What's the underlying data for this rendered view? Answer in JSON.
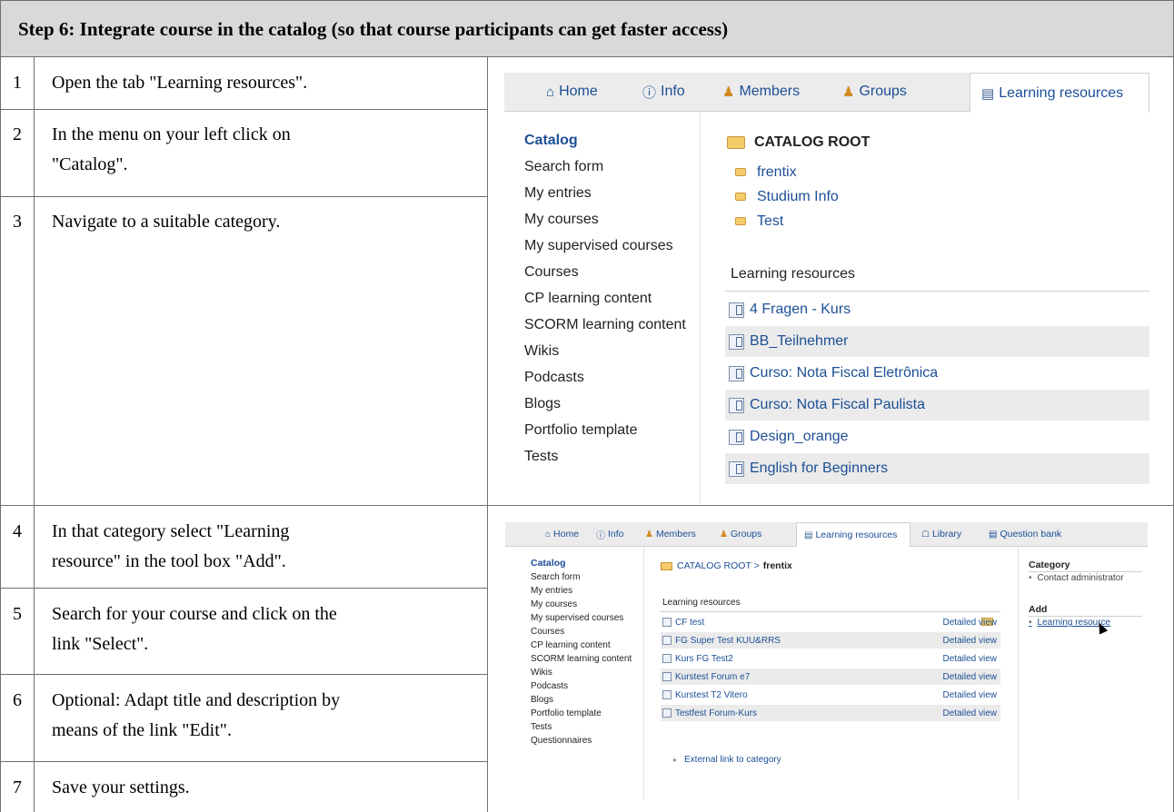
{
  "header": {
    "title": "Step 6: Integrate course in the catalog (so that course participants can get faster access)"
  },
  "steps": [
    {
      "num": "1",
      "lines": [
        "Open the tab \"Learning resources\"."
      ]
    },
    {
      "num": "2",
      "lines": [
        "In the menu on your left click on",
        "\"Catalog\"."
      ]
    },
    {
      "num": "3",
      "lines": [
        "Navigate to a suitable category."
      ]
    },
    {
      "num": "4",
      "lines": [
        "In that category select \"Learning",
        "resource\" in the tool box \"Add\"."
      ]
    },
    {
      "num": "5",
      "lines": [
        "Search for your course and click on the",
        "link \"Select\"."
      ]
    },
    {
      "num": "6",
      "lines": [
        "Optional: Adapt title and description by",
        "means of the link \"Edit\"."
      ]
    },
    {
      "num": "7",
      "lines": [
        "Save your settings."
      ]
    }
  ],
  "shot1": {
    "tabs": [
      {
        "label": "Home",
        "icon": "house-icon"
      },
      {
        "label": "Info",
        "icon": "info-icon"
      },
      {
        "label": "Members",
        "icon": "members-icon"
      },
      {
        "label": "Groups",
        "icon": "groups-icon"
      },
      {
        "label": "Learning resources",
        "icon": "learning-resources-icon"
      }
    ],
    "menu": [
      "Catalog",
      "Search form",
      "My entries",
      "My courses",
      "My supervised courses",
      "Courses",
      "CP learning content",
      "SCORM learning content",
      "Wikis",
      "Podcasts",
      "Blogs",
      "Portfolio template",
      "Tests"
    ],
    "catalog_root": "CATALOG ROOT",
    "categories": [
      "frentix",
      "Studium Info",
      "Test"
    ],
    "lr_heading": "Learning resources",
    "resources": [
      "4 Fragen - Kurs",
      "BB_Teilnehmer",
      "Curso: Nota Fiscal Eletrônica",
      "Curso: Nota Fiscal Paulista",
      "Design_orange",
      "English for Beginners"
    ]
  },
  "shot2": {
    "tabs": [
      {
        "label": "Home",
        "icon": "house-icon"
      },
      {
        "label": "Info",
        "icon": "info-icon"
      },
      {
        "label": "Members",
        "icon": "members-icon"
      },
      {
        "label": "Groups",
        "icon": "groups-icon"
      },
      {
        "label": "Learning resources",
        "icon": "learning-resources-icon"
      },
      {
        "label": "Library",
        "icon": "library-icon"
      },
      {
        "label": "Question bank",
        "icon": "question-bank-icon"
      }
    ],
    "menu": [
      "Catalog",
      "Search form",
      "My entries",
      "My courses",
      "My supervised courses",
      "Courses",
      "CP learning content",
      "SCORM learning content",
      "Wikis",
      "Podcasts",
      "Blogs",
      "Portfolio template",
      "Tests",
      "Questionnaires"
    ],
    "breadcrumb_root": "CATALOG ROOT >",
    "breadcrumb_current": "frentix",
    "lr_heading": "Learning resources",
    "rows": [
      {
        "name": "CF test",
        "link": "Detailed view"
      },
      {
        "name": "FG Super Test KUU&RRS",
        "link": "Detailed view"
      },
      {
        "name": "Kurs FG Test2",
        "link": "Detailed view"
      },
      {
        "name": "Kurstest Forum e7",
        "link": "Detailed view"
      },
      {
        "name": "Kurstest T2 Vitero",
        "link": "Detailed view"
      },
      {
        "name": "Testfest Forum-Kurs",
        "link": "Detailed view"
      }
    ],
    "external_link": "External link to category",
    "category_heading": "Category",
    "category_item": "Contact administrator",
    "add_heading": "Add",
    "add_item": "Learning resource"
  }
}
